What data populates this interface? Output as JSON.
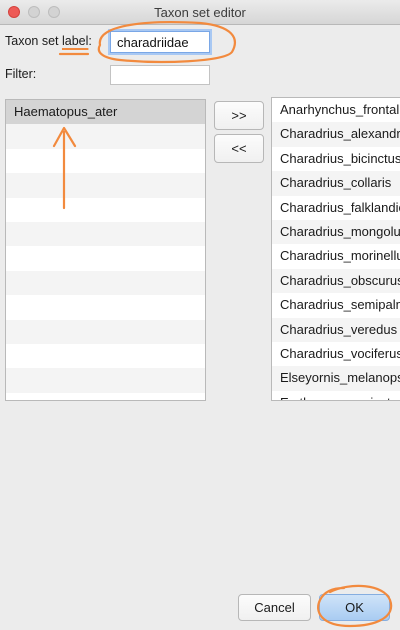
{
  "window": {
    "title": "Taxon set editor"
  },
  "form": {
    "label_prefix": "Taxon set ",
    "label_underlined": "label",
    "label_suffix": ":",
    "label_value": "charadriidae",
    "filter_label": "Filter:",
    "filter_value": ""
  },
  "selected_list": {
    "items": [
      "Haematopus_ater"
    ]
  },
  "buttons": {
    "add": ">>",
    "remove": "<<",
    "cancel": "Cancel",
    "ok": "OK"
  },
  "available_list": {
    "items": [
      "Anarhynchus_frontalis",
      "Charadrius_alexandrinus",
      "Charadrius_bicinctus",
      "Charadrius_collaris",
      "Charadrius_falklandicus",
      "Charadrius_mongolus",
      "Charadrius_morinellus",
      "Charadrius_obscurus",
      "Charadrius_semipalmatus",
      "Charadrius_veredus",
      "Charadrius_vociferus",
      "Elseyornis_melanops",
      "Erythrogonys_cinctus"
    ]
  },
  "annotation_color": "#f28a3e"
}
